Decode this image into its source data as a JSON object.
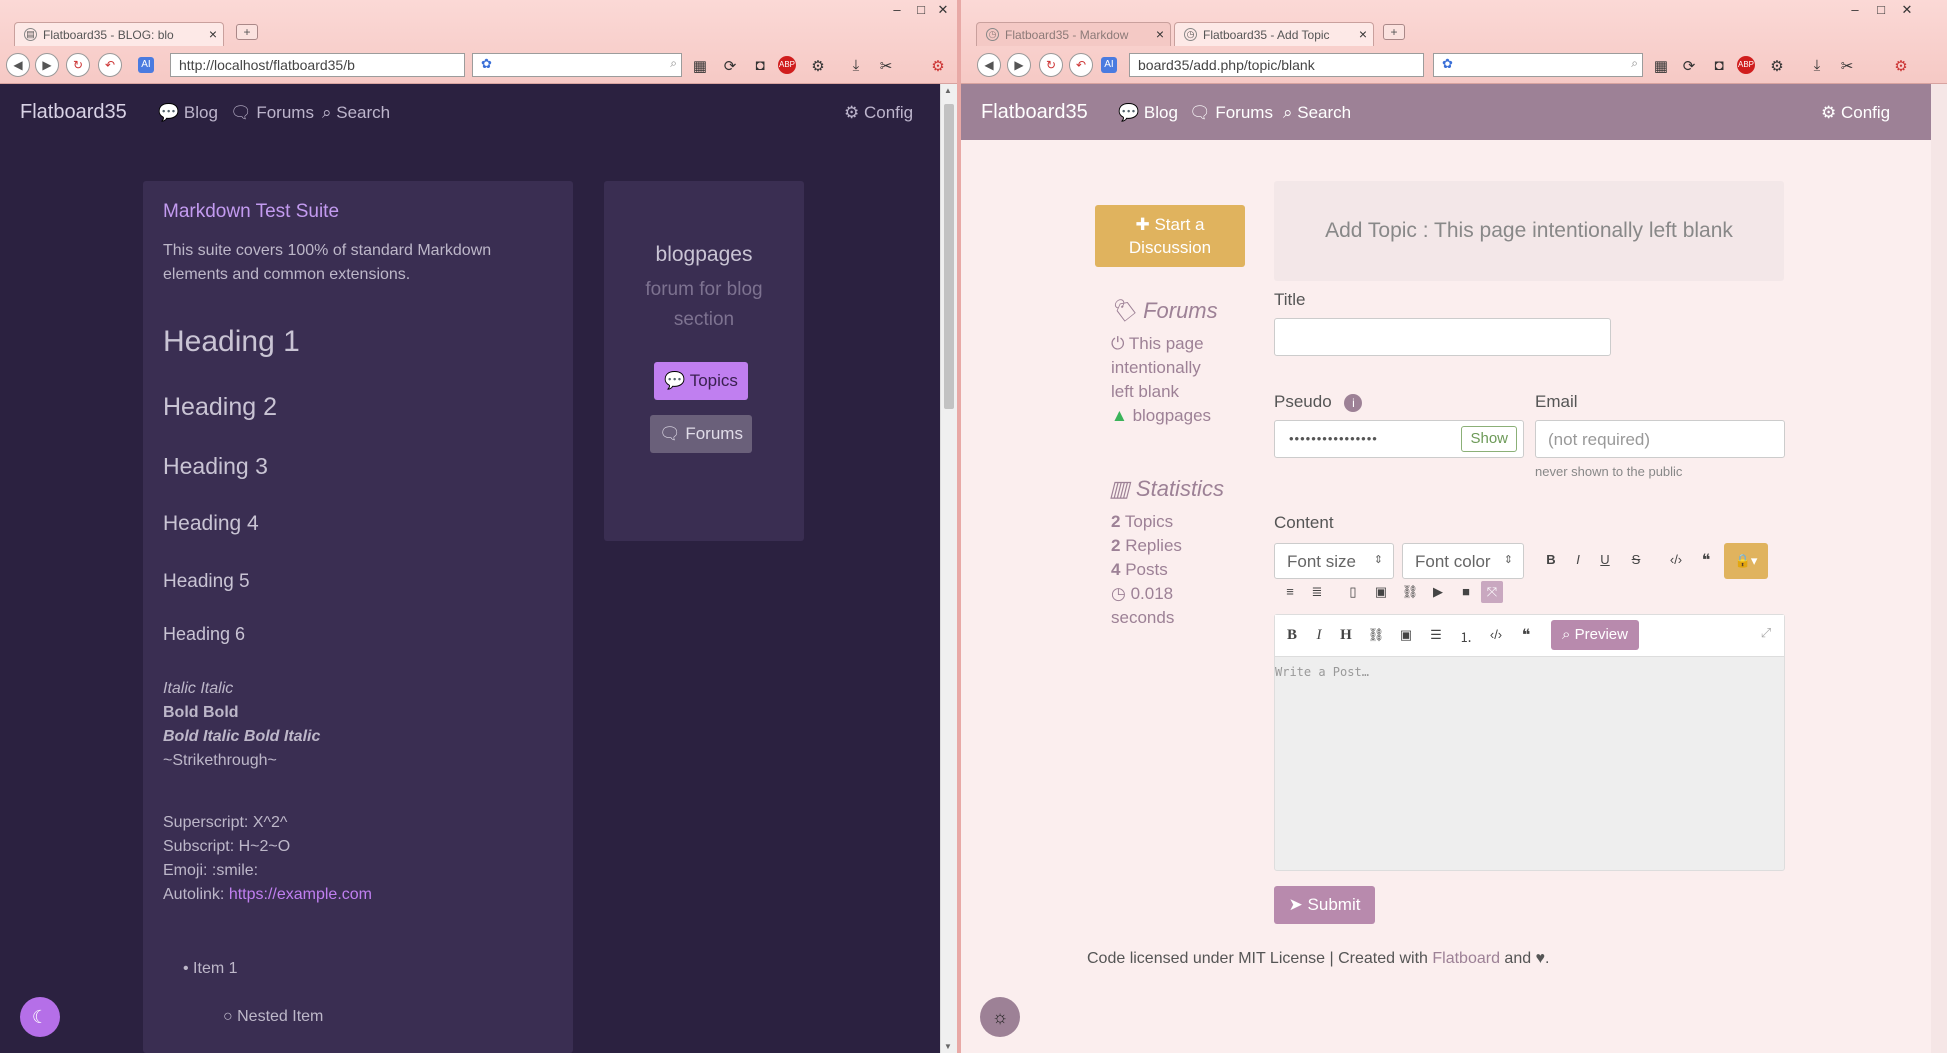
{
  "left": {
    "tab_title": "Flatboard35 - BLOG: blo",
    "url": "http://localhost/flatboard35/b",
    "nav": {
      "brand": "Flatboard35",
      "blog": "Blog",
      "forums": "Forums",
      "search": "Search",
      "config": "Config"
    },
    "md": {
      "title": "Markdown Test Suite",
      "intro": "This suite covers 100% of standard Markdown elements and common extensions.",
      "h1": "Heading 1",
      "h2": "Heading 2",
      "h3": "Heading 3",
      "h4": "Heading 4",
      "h5": "Heading 5",
      "h6": "Heading 6",
      "italic": "Italic Italic",
      "bold": "Bold Bold",
      "bolditalic": "Bold Italic Bold Italic",
      "strike": "~Strikethrough~",
      "sup": "Superscript: X^2^",
      "sub": "Subscript: H~2~O",
      "emoji": "Emoji: :smile:",
      "autolink_label": "Autolink: ",
      "autolink_url": "https://example.com",
      "item1": "Item 1",
      "nested": "Nested Item"
    },
    "side": {
      "name": "blogpages",
      "desc": "forum for blog section",
      "topics_btn": "Topics",
      "forums_btn": "Forums"
    }
  },
  "right": {
    "tab_inactive": "Flatboard35 - Markdow",
    "tab_active": "Flatboard35 - Add Topic",
    "url": "board35/add.php/topic/blank",
    "nav": {
      "brand": "Flatboard35",
      "blog": "Blog",
      "forums": "Forums",
      "search": "Search",
      "config": "Config"
    },
    "start_btn": "Start a Discussion",
    "forums_heading": "Forums",
    "forum_link": "This page intentionally left blank",
    "forum_link2": "blogpages",
    "stats_heading": "Statistics",
    "stats": {
      "topics_n": "2",
      "topics": "Topics",
      "replies_n": "2",
      "replies": "Replies",
      "posts_n": "4",
      "posts": "Posts",
      "time": "0.018 seconds"
    },
    "header": "Add Topic : This page intentionally left blank",
    "title_label": "Title",
    "pseudo_label": "Pseudo",
    "pseudo_value": "••••••••••••••••",
    "show_btn": "Show",
    "email_label": "Email",
    "email_placeholder": "(not required)",
    "email_hint": "never shown to the public",
    "content_label": "Content",
    "font_size": "Font size",
    "font_color": "Font color",
    "preview_btn": "Preview",
    "editor_placeholder": "Write a Post…",
    "submit_btn": "Submit",
    "footer_pre": "Code licensed under MIT License | Created with ",
    "footer_link": "Flatboard",
    "footer_post": " and ♥."
  },
  "colors": {
    "dark_bg": "#2b2140",
    "card_bg": "#3a2e52",
    "accent_purple": "#c07ff0",
    "nav_mauve": "#9d8196",
    "gold": "#e0b35e"
  }
}
